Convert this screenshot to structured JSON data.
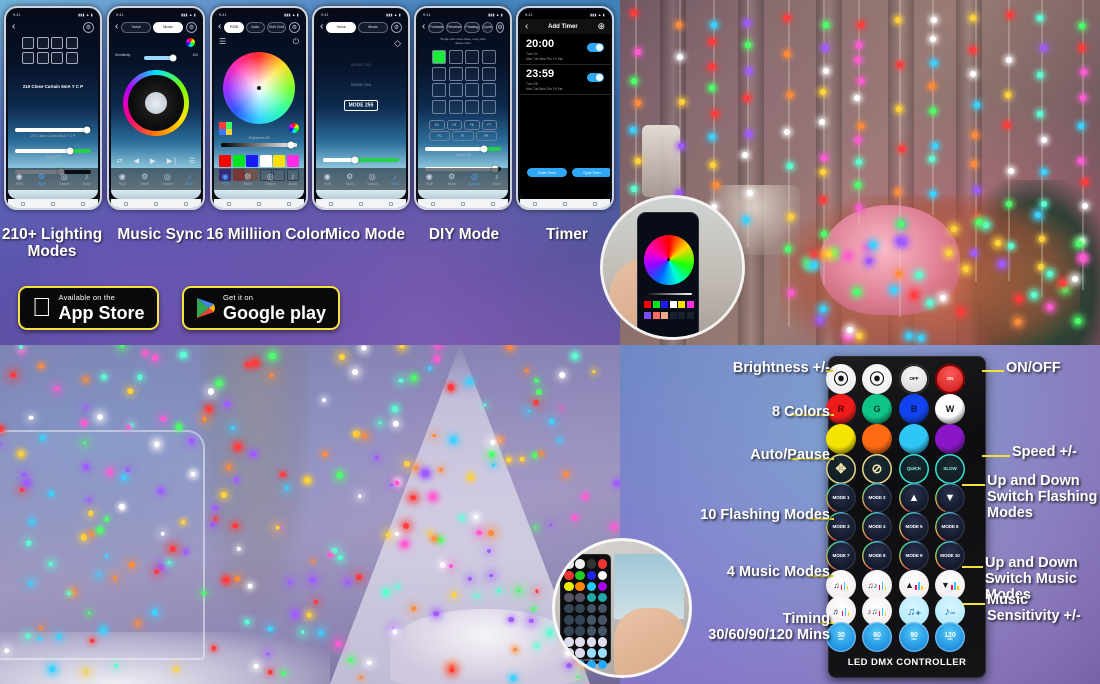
{
  "top": {
    "phones": [
      {
        "caption": "210+ Lighting\nModes",
        "statusbar_time": "9:41",
        "screen": "modes",
        "mode_title": "210 Close Curtain 5mA Y C P",
        "sliders": [
          {
            "label": "210 Close Curtain 5mA Y C P",
            "value": 95,
            "type": "white"
          },
          {
            "label": "Speed  75",
            "value": 72,
            "type": "green"
          },
          {
            "label": "Brightness  75",
            "value": 60,
            "type": "white"
          }
        ]
      },
      {
        "caption": "Music Sync",
        "statusbar_time": "9:41",
        "screen": "music",
        "tabs": [
          "Voice",
          "Music"
        ],
        "active_tab": "Music",
        "sensitivity_label": "Sensitivity",
        "sensitivity_value": "100",
        "transport": [
          "shuffle",
          "previous",
          "play",
          "next",
          "list"
        ]
      },
      {
        "caption": "16 Milliion Color",
        "statusbar_time": "9:41",
        "screen": "color",
        "tabs": [
          "RGB",
          "Auto",
          "Soft Grid"
        ],
        "active_tab": "RGB",
        "brightness_label": "Brightness  85",
        "swatches_row1": [
          "#ff0000",
          "#00e61e",
          "#1a1aff",
          "#ffffff",
          "#ffe000",
          "#ff2ee6"
        ],
        "swatches_row2": [
          "#7a4df0",
          "#ff6b5c",
          "#f0a98f",
          "",
          "",
          ""
        ]
      },
      {
        "caption": "Mico Mode",
        "statusbar_time": "9:41",
        "screen": "mico",
        "tabs": [
          "Voice",
          "Music"
        ],
        "active_tab": "Voice",
        "mode_list": [
          "MODE 253",
          "MODE 254",
          "MODE 255"
        ],
        "selected_mode": "MODE 255",
        "sensitivity_label": "sensitivity  63"
      },
      {
        "caption": "DIY Mode",
        "statusbar_time": "9:41",
        "screen": "diy",
        "tabs": [
          "Forward",
          "Reverse",
          "Flowing",
          "Cycle"
        ],
        "hint": "Single click show base, Long click\ndelete color",
        "sliders": [
          {
            "label": "Speed  75",
            "value": 78,
            "type": "green"
          },
          {
            "label": "Brightness  100",
            "value": 92,
            "type": "white"
          }
        ],
        "fn_keys_row1": [
          "E4",
          "F5",
          "F6",
          "F7"
        ],
        "fn_keys_row2": [
          "FC",
          "FL",
          "FR"
        ]
      },
      {
        "caption": "Timer",
        "statusbar_time": "9:41",
        "screen": "timer",
        "title": "Add Timer",
        "timers": [
          {
            "time": "20:00",
            "action": "Turn On",
            "days": "Mon Tue Wed Thu Fri Sat",
            "enabled": true
          },
          {
            "time": "23:59",
            "action": "Turn Off",
            "days": "Mon Tue Wed Thu Fri Sat",
            "enabled": true
          }
        ],
        "buttons": [
          "Order Timer",
          "Cycle Timer"
        ]
      }
    ],
    "store_badges": [
      {
        "small": "Available on the",
        "big": "App Store",
        "icon": "apple-icon"
      },
      {
        "small": "Get it on",
        "big": "Google play",
        "icon": "google-play-icon"
      }
    ]
  },
  "remote": {
    "name": "LED DMX CONTROLLER",
    "brightness": [
      {
        "label": "brightness-up",
        "glyph": "▲"
      },
      {
        "label": "brightness-down",
        "glyph": "▼"
      }
    ],
    "power": [
      {
        "label": "OFF",
        "color": "#f2f2f2"
      },
      {
        "label": "ON",
        "color": "#e02020"
      }
    ],
    "colors": [
      {
        "label": "R",
        "hex": "#ef1b1b",
        "text": "#5a0000"
      },
      {
        "label": "G",
        "hex": "#0fc489",
        "text": "#00402a"
      },
      {
        "label": "B",
        "hex": "#1144ee",
        "text": "#00114d"
      },
      {
        "label": "W",
        "hex": "#ffffff",
        "text": "#111111"
      },
      {
        "label": "",
        "hex": "#f5e400",
        "text": "#333"
      },
      {
        "label": "",
        "hex": "#ff6a12",
        "text": "#333"
      },
      {
        "label": "",
        "hex": "#2ec7f5",
        "text": "#333"
      },
      {
        "label": "",
        "hex": "#8b16c8",
        "text": "#333"
      }
    ],
    "auto_pause": [
      {
        "label": "auto-icon",
        "glyph": "✦"
      },
      {
        "label": "pause-icon",
        "glyph": "⊘"
      }
    ],
    "speed": [
      {
        "label": "QUICK"
      },
      {
        "label": "SLOW"
      }
    ],
    "mode_updown": [
      {
        "label": "mode-up",
        "glyph": "▲"
      },
      {
        "label": "mode-down",
        "glyph": "▼"
      }
    ],
    "modes": [
      "MODE 1",
      "MODE 2",
      "MODE 3",
      "MODE 4",
      "MODE 5",
      "MODE 6",
      "MODE 7",
      "MODE 8",
      "MODE 9",
      "MODE 10"
    ],
    "music_modes": [
      "music-mode-1",
      "music-mode-2",
      "music-mode-3",
      "music-mode-4"
    ],
    "music_updown": [
      "music-mode-up",
      "music-mode-down"
    ],
    "music_sensitivity": [
      "sensitivity-up",
      "sensitivity-down"
    ],
    "timers": [
      {
        "num": "30",
        "unit": "MIN"
      },
      {
        "num": "60",
        "unit": "MIN"
      },
      {
        "num": "90",
        "unit": "MIN"
      },
      {
        "num": "120",
        "unit": "MIN"
      }
    ]
  },
  "callouts": {
    "left": [
      {
        "text": "Brightness +/-",
        "name": "callout-brightness"
      },
      {
        "text": "8 Colors",
        "name": "callout-colors"
      },
      {
        "text": "Auto/Pause",
        "name": "callout-auto-pause"
      },
      {
        "text": "10 Flashing Modes",
        "name": "callout-flashing-modes"
      },
      {
        "text": "4 Music Modes",
        "name": "callout-music-modes"
      },
      {
        "text": "Timing\n30/60/90/120 Mins",
        "name": "callout-timing"
      }
    ],
    "right": [
      {
        "text": "ON/OFF",
        "name": "callout-onoff"
      },
      {
        "text": "Speed +/-",
        "name": "callout-speed"
      },
      {
        "text": "Up and Down\nSwitch Flashing\nModes",
        "name": "callout-switch-flashing"
      },
      {
        "text": "Up and Down\nSwitch Music Modes",
        "name": "callout-switch-music"
      },
      {
        "text": "Music\nSensitivity +/-",
        "name": "callout-music-sensitivity"
      }
    ]
  },
  "accent": {
    "yellow": "#f2e13a",
    "white": "#ffffff"
  }
}
